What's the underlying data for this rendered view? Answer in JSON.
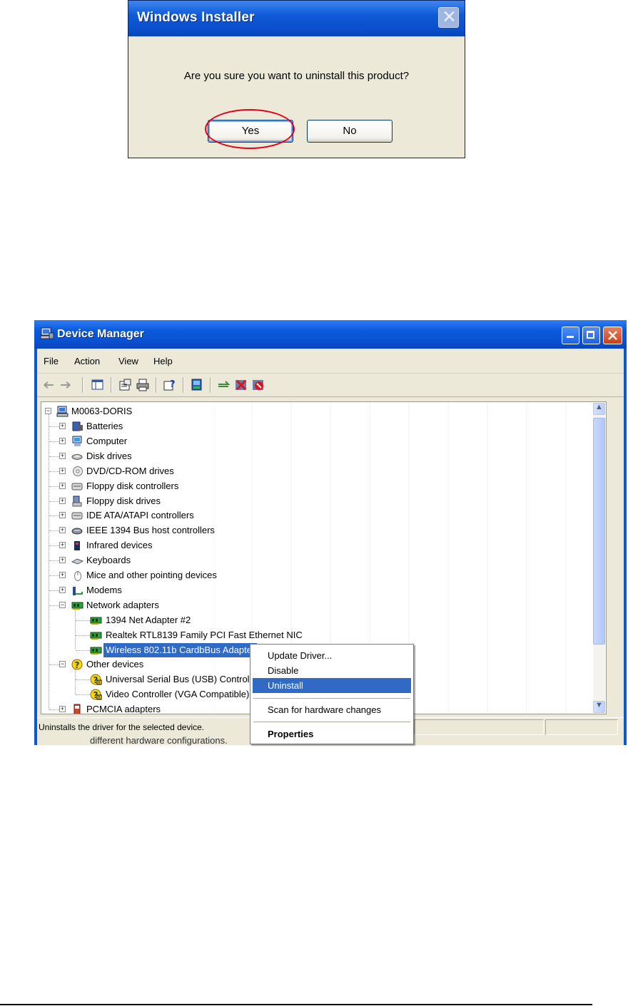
{
  "installer_dialog": {
    "title": "Windows Installer",
    "close_glyph": "✕",
    "message": "Are you sure you want to uninstall this product?",
    "yes_label": "Yes",
    "no_label": "No",
    "highlight_color": "#e3001b"
  },
  "device_manager": {
    "title": "Device Manager",
    "menu": [
      "File",
      "Action",
      "View",
      "Help"
    ],
    "toolbar_icons": [
      "back-icon",
      "forward-icon",
      "console-tree-icon",
      "properties-icon",
      "print-icon",
      "help-icon",
      "scan-hardware-icon",
      "update-driver-icon",
      "disable-icon",
      "uninstall-icon"
    ],
    "tree": {
      "root": "M0063-DORIS",
      "items": [
        {
          "label": "Batteries",
          "icon": "battery-icon"
        },
        {
          "label": "Computer",
          "icon": "computer-icon"
        },
        {
          "label": "Disk drives",
          "icon": "disk-drive-icon"
        },
        {
          "label": "DVD/CD-ROM drives",
          "icon": "dvd-icon"
        },
        {
          "label": "Floppy disk controllers",
          "icon": "controller-icon"
        },
        {
          "label": "Floppy disk drives",
          "icon": "floppy-icon"
        },
        {
          "label": "IDE ATA/ATAPI controllers",
          "icon": "controller-icon"
        },
        {
          "label": "IEEE 1394 Bus host controllers",
          "icon": "ieee1394-icon"
        },
        {
          "label": "Infrared devices",
          "icon": "infrared-icon"
        },
        {
          "label": "Keyboards",
          "icon": "keyboard-icon"
        },
        {
          "label": "Mice and other pointing devices",
          "icon": "mouse-icon"
        },
        {
          "label": "Modems",
          "icon": "modem-icon"
        },
        {
          "label": "Network adapters",
          "icon": "network-adapter-icon"
        },
        {
          "label": "1394 Net Adapter #2",
          "icon": "network-adapter-icon"
        },
        {
          "label": "Realtek RTL8139 Family PCI Fast Ethernet NIC",
          "icon": "network-adapter-icon"
        },
        {
          "label": "Wireless 802.11b CardbBus Adapter",
          "icon": "network-adapter-icon"
        },
        {
          "label": "Other devices",
          "icon": "unknown-device-icon"
        },
        {
          "label": "Universal Serial Bus (USB) Controller",
          "icon": "warning-device-icon"
        },
        {
          "label": "Video Controller (VGA Compatible)",
          "icon": "warning-device-icon"
        },
        {
          "label": "PCMCIA adapters",
          "icon": "pcmcia-icon"
        }
      ]
    },
    "status_text": "Uninstalls the driver for the selected device.",
    "below_text": "different hardware configurations."
  },
  "context_menu": {
    "items": [
      "Update Driver...",
      "Disable",
      "Uninstall",
      "Scan for hardware changes",
      "Properties"
    ],
    "highlighted": "Uninstall"
  },
  "colors": {
    "xp_title_blue": "#0a52d3",
    "selection_blue": "#316ac5",
    "dialog_face": "#ece9d8"
  }
}
